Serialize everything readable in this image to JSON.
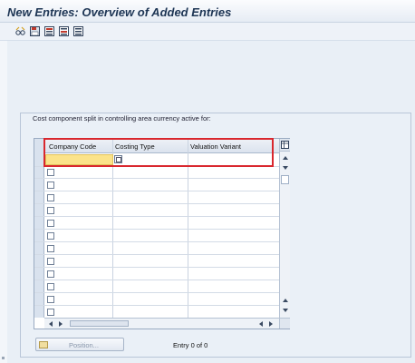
{
  "window": {
    "title": "New Entries: Overview of Added Entries"
  },
  "toolbar": {
    "icons": [
      "glasses-icon",
      "save-icon",
      "select-all-icon",
      "select-block-icon",
      "deselect-icon"
    ]
  },
  "group": {
    "caption": "Cost component split in controlling area currency active for:"
  },
  "table": {
    "columns": [
      "Company Code",
      "Costing Type",
      "Valuation Variant"
    ],
    "row_count_visible": 13,
    "settings_icon": "table-settings-icon"
  },
  "footer": {
    "position_label": "Position...",
    "entry_text": "Entry 0 of 0"
  },
  "colors": {
    "title": "#1d3554",
    "highlight_border": "#d9272e",
    "input_required": "#fbe38a",
    "background": "#e9eff6"
  }
}
